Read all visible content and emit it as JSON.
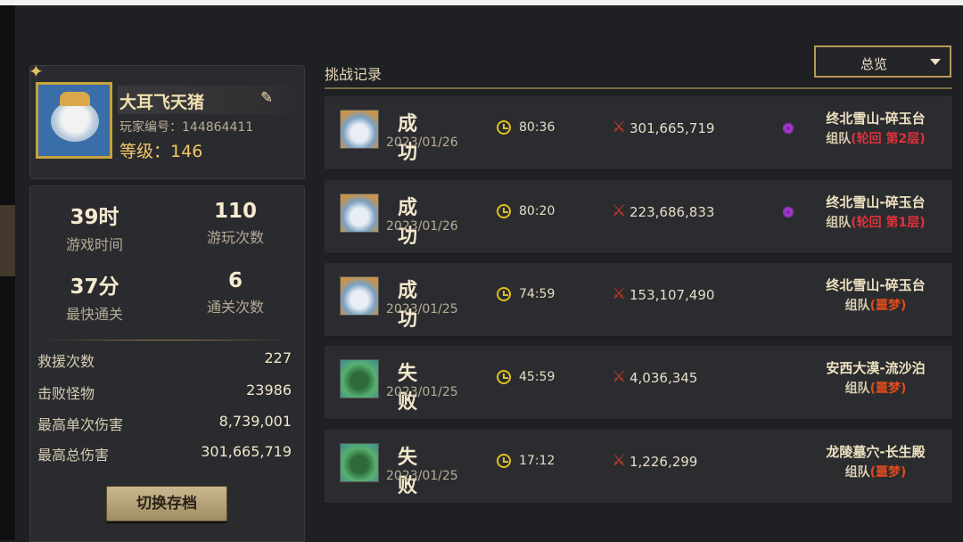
{
  "profile": {
    "name": "大耳飞天猪",
    "player_id_label": "玩家编号：",
    "player_id": "144864411",
    "level_label": "等级：",
    "level": "146"
  },
  "stats": {
    "play_time": {
      "value": "39时",
      "label": "游戏时间"
    },
    "play_count": {
      "value": "110",
      "label": "游玩次数"
    },
    "fastest": {
      "value": "37分",
      "label": "最快通关"
    },
    "clear_count": {
      "value": "6",
      "label": "通关次数"
    },
    "rows": [
      {
        "label": "救援次数",
        "value": "227"
      },
      {
        "label": "击败怪物",
        "value": "23986"
      },
      {
        "label": "最高单次伤害",
        "value": "8,739,001"
      },
      {
        "label": "最高总伤害",
        "value": "301,665,719"
      }
    ],
    "switch_button": "切换存档"
  },
  "records": {
    "title": "挑战记录",
    "filter": "总览",
    "items": [
      {
        "result": "成功",
        "outcome": "win",
        "date": "2023/01/26",
        "time": "80:36",
        "damage": "301,665,719",
        "stage": "终北雪山-碎玉台",
        "team": "组队",
        "difficulty": "(轮回 第2层)",
        "cycle": true
      },
      {
        "result": "成功",
        "outcome": "win",
        "date": "2023/01/26",
        "time": "80:20",
        "damage": "223,686,833",
        "stage": "终北雪山-碎玉台",
        "team": "组队",
        "difficulty": "(轮回 第1层)",
        "cycle": true
      },
      {
        "result": "成功",
        "outcome": "win",
        "date": "2023/01/25",
        "time": "74:59",
        "damage": "153,107,490",
        "stage": "终北雪山-碎玉台",
        "team": "组队",
        "difficulty": "(噩梦)",
        "cycle": false
      },
      {
        "result": "失败",
        "outcome": "lose",
        "date": "2023/01/25",
        "time": "45:59",
        "damage": "4,036,345",
        "stage": "安西大漠-流沙泊",
        "team": "组队",
        "difficulty": "(噩梦)",
        "cycle": false
      },
      {
        "result": "失败",
        "outcome": "lose",
        "date": "2023/01/25",
        "time": "17:12",
        "damage": "1,226,299",
        "stage": "龙陵墓穴-长生殿",
        "team": "组队",
        "difficulty": "(噩梦)",
        "cycle": false
      }
    ]
  },
  "colors": {
    "accent": "#c9a23c",
    "difficulty": "#e04a1a",
    "panel": "#2a2b2e"
  }
}
